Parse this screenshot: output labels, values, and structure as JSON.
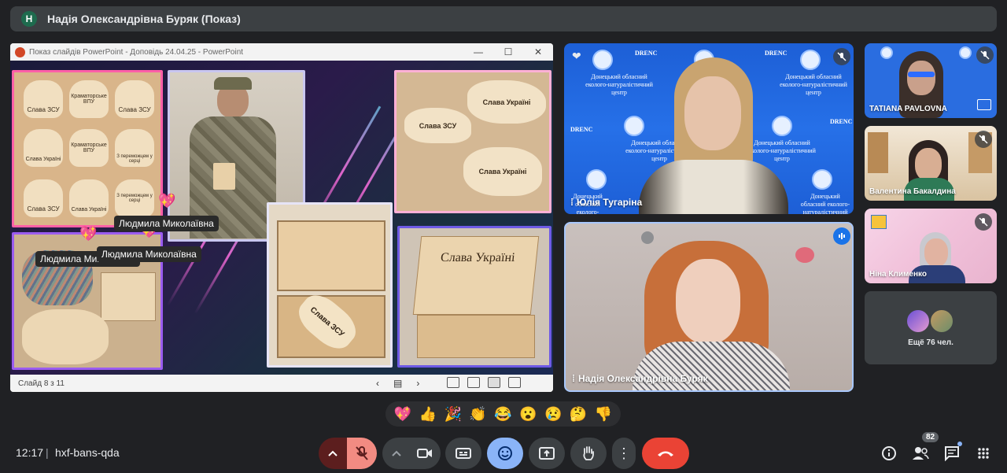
{
  "presenter_banner": {
    "avatar_letter": "Н",
    "title": "Надія Олександрівна Буряк (Показ)"
  },
  "presentation": {
    "window_title": "Показ слайдів PowerPoint - Доповідь 24.04.25 - PowerPoint",
    "slide_status": "Слайд 8 з 11",
    "name_tags": [
      "Людмила Миколаївна",
      "Людмила Миколаївна",
      "Людмила Миколаївна"
    ],
    "slide_texts": {
      "tag_zsu": "Слава ЗСУ",
      "tag_kram": "Краматорське ВПУ",
      "tag_ukr": "Слава Україні",
      "tag_zmoi": "З переможцем у серці",
      "map_zsu": "Слава ЗСУ",
      "map_ukr1": "Слава Україні",
      "map_ukr2": "Слава Україні",
      "box_lid": "Слава Україні",
      "box_tag_zsu": "Слава ЗСУ"
    }
  },
  "participants": {
    "tugarina": {
      "name": "Юлія Тугаріна",
      "bg_org": "Донецький обласний еколого-натуралістичний центр",
      "bg_brand": "DRENC"
    },
    "buriak": {
      "name": "Надія Олександрівна Буряк"
    },
    "pavlovna": {
      "name": "TATIANA PAVLOVNA"
    },
    "bakaldina": {
      "name": "Валентина Бакалдина"
    },
    "klymenko": {
      "name": "Ніна Клименко"
    },
    "more": {
      "label": "Ещё 76 чел."
    }
  },
  "reactions": [
    "💖",
    "👍",
    "🎉",
    "👏",
    "😂",
    "😮",
    "😢",
    "🤔",
    "👎"
  ],
  "bottom_bar": {
    "time": "12:17",
    "separator": "|",
    "meeting_code": "hxf-bans-qda",
    "participants_count": "82"
  },
  "colors": {
    "background": "#202124",
    "surface": "#3c4043",
    "end_call": "#ea4335",
    "active_blue": "#8ab4f8",
    "speaking": "#1a73e8"
  }
}
